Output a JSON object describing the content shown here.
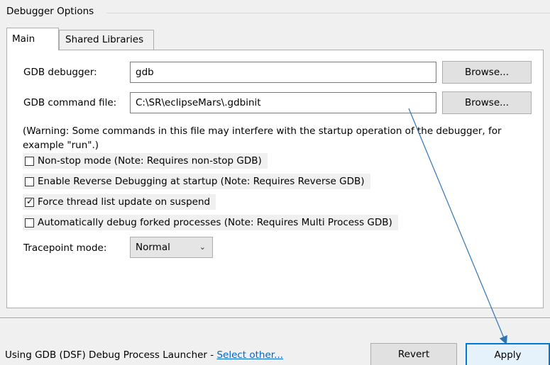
{
  "group": {
    "title": "Debugger Options"
  },
  "tabs": [
    {
      "label": "Main",
      "active": true
    },
    {
      "label": "Shared Libraries",
      "active": false
    }
  ],
  "gdb_debugger": {
    "label": "GDB debugger:",
    "value": "gdb",
    "browse_label": "Browse..."
  },
  "gdb_command_file": {
    "label": "GDB command file:",
    "value": "C:\\SR\\eclipseMars\\.gdbinit",
    "browse_label": "Browse..."
  },
  "warning": "(Warning: Some commands in this file may interfere with the startup operation of the debugger, for example \"run\".)",
  "options": [
    {
      "label": "Non-stop mode (Note: Requires non-stop GDB)",
      "checked": false
    },
    {
      "label": "Enable Reverse Debugging at startup (Note: Requires Reverse GDB)",
      "checked": false
    },
    {
      "label": "Force thread list update on suspend",
      "checked": true
    },
    {
      "label": "Automatically debug forked processes (Note: Requires Multi Process GDB)",
      "checked": false
    }
  ],
  "tracepoint": {
    "label": "Tracepoint mode:",
    "value": "Normal"
  },
  "footer": {
    "launcher_text": "Using GDB (DSF) Debug Process Launcher - ",
    "select_other_link": "Select other...",
    "revert_label": "Revert",
    "apply_label": "Apply"
  },
  "colors": {
    "accent": "#0078d7",
    "arrow": "#2e75b6",
    "link": "#0066cc"
  }
}
